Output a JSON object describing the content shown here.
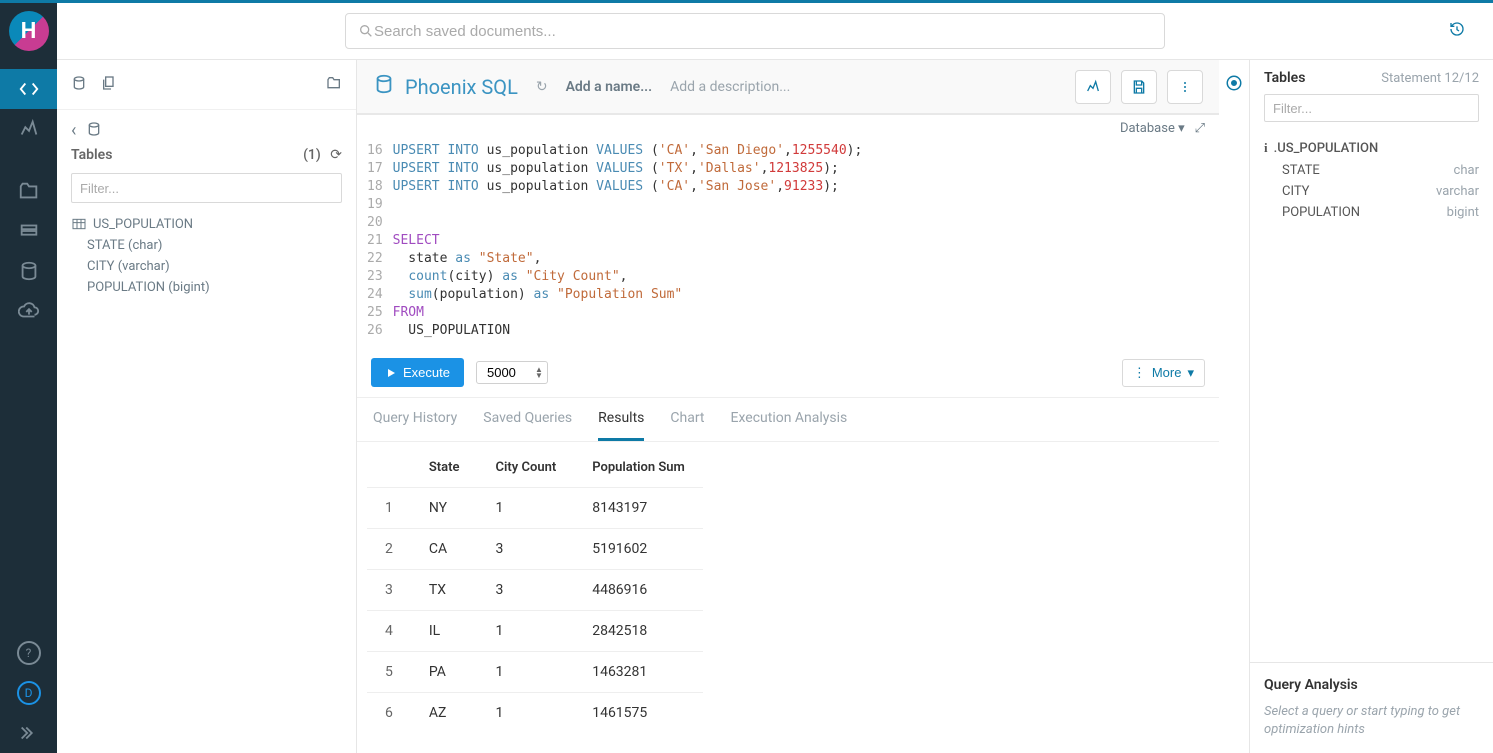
{
  "search": {
    "placeholder": "Search saved documents..."
  },
  "leftRail": {
    "icons": [
      "editor",
      "dashboards",
      "files",
      "tables",
      "database",
      "cloud"
    ],
    "bottom": [
      "help",
      "user",
      "expand"
    ]
  },
  "sidebar": {
    "crumb_back": "‹",
    "heading": "Tables",
    "count": "(1)",
    "filter_placeholder": "Filter...",
    "table": {
      "name": "US_POPULATION",
      "columns": [
        {
          "name": "STATE",
          "type": "char"
        },
        {
          "name": "CITY",
          "type": "varchar"
        },
        {
          "name": "POPULATION",
          "type": "bigint"
        }
      ]
    }
  },
  "query": {
    "engine": "Phoenix SQL",
    "addName": "Add a name...",
    "addDesc": "Add a description...",
    "dbLabel": "Database",
    "execute": "Execute",
    "limit": "5000",
    "more": "More",
    "code": [
      {
        "n": 16,
        "tokens": [
          {
            "t": "UPSERT",
            "c": "kw"
          },
          {
            "t": " "
          },
          {
            "t": "INTO",
            "c": "kw"
          },
          {
            "t": " us_population "
          },
          {
            "t": "VALUES",
            "c": "kw"
          },
          {
            "t": " ("
          },
          {
            "t": "'CA'",
            "c": "str"
          },
          {
            "t": ","
          },
          {
            "t": "'San Diego'",
            "c": "str"
          },
          {
            "t": ","
          },
          {
            "t": "1255540",
            "c": "num"
          },
          {
            "t": ");"
          }
        ]
      },
      {
        "n": 17,
        "tokens": [
          {
            "t": "UPSERT",
            "c": "kw"
          },
          {
            "t": " "
          },
          {
            "t": "INTO",
            "c": "kw"
          },
          {
            "t": " us_population "
          },
          {
            "t": "VALUES",
            "c": "kw"
          },
          {
            "t": " ("
          },
          {
            "t": "'TX'",
            "c": "str"
          },
          {
            "t": ","
          },
          {
            "t": "'Dallas'",
            "c": "str"
          },
          {
            "t": ","
          },
          {
            "t": "1213825",
            "c": "num"
          },
          {
            "t": ");"
          }
        ]
      },
      {
        "n": 18,
        "tokens": [
          {
            "t": "UPSERT",
            "c": "kw"
          },
          {
            "t": " "
          },
          {
            "t": "INTO",
            "c": "kw"
          },
          {
            "t": " us_population "
          },
          {
            "t": "VALUES",
            "c": "kw"
          },
          {
            "t": " ("
          },
          {
            "t": "'CA'",
            "c": "str"
          },
          {
            "t": ","
          },
          {
            "t": "'San Jose'",
            "c": "str"
          },
          {
            "t": ","
          },
          {
            "t": "91233",
            "c": "num"
          },
          {
            "t": ");"
          }
        ]
      },
      {
        "n": 19,
        "tokens": []
      },
      {
        "n": 20,
        "tokens": []
      },
      {
        "n": 21,
        "tokens": [
          {
            "t": "SELECT",
            "c": "kw2"
          }
        ]
      },
      {
        "n": 22,
        "tokens": [
          {
            "t": "  state "
          },
          {
            "t": "as",
            "c": "kw"
          },
          {
            "t": " "
          },
          {
            "t": "\"State\"",
            "c": "str"
          },
          {
            "t": ","
          }
        ]
      },
      {
        "n": 23,
        "tokens": [
          {
            "t": "  "
          },
          {
            "t": "count",
            "c": "kw"
          },
          {
            "t": "(city) "
          },
          {
            "t": "as",
            "c": "kw"
          },
          {
            "t": " "
          },
          {
            "t": "\"City Count\"",
            "c": "str"
          },
          {
            "t": ","
          }
        ]
      },
      {
        "n": 24,
        "tokens": [
          {
            "t": "  "
          },
          {
            "t": "sum",
            "c": "kw"
          },
          {
            "t": "(population) "
          },
          {
            "t": "as",
            "c": "kw"
          },
          {
            "t": " "
          },
          {
            "t": "\"Population Sum\"",
            "c": "str"
          }
        ]
      },
      {
        "n": 25,
        "tokens": [
          {
            "t": "FROM",
            "c": "kw2"
          }
        ]
      },
      {
        "n": 26,
        "tokens": [
          {
            "t": "  US_POPULATION"
          }
        ]
      }
    ]
  },
  "tabs": {
    "items": [
      "Query History",
      "Saved Queries",
      "Results",
      "Chart",
      "Execution Analysis"
    ],
    "active": "Results"
  },
  "results": {
    "columns": [
      "",
      "State",
      "City Count",
      "Population Sum"
    ],
    "rows": [
      [
        "1",
        "NY",
        "1",
        "8143197"
      ],
      [
        "2",
        "CA",
        "3",
        "5191602"
      ],
      [
        "3",
        "TX",
        "3",
        "4486916"
      ],
      [
        "4",
        "IL",
        "1",
        "2842518"
      ],
      [
        "5",
        "PA",
        "1",
        "1463281"
      ],
      [
        "6",
        "AZ",
        "1",
        "1461575"
      ]
    ]
  },
  "rightPanel": {
    "heading": "Tables",
    "statement": "Statement 12/12",
    "filter_placeholder": "Filter...",
    "table": {
      "name": ".US_POPULATION",
      "columns": [
        {
          "name": "STATE",
          "type": "char"
        },
        {
          "name": "CITY",
          "type": "varchar"
        },
        {
          "name": "POPULATION",
          "type": "bigint"
        }
      ]
    },
    "qa_heading": "Query Analysis",
    "qa_hint": "Select a query or start typing to get optimization hints"
  }
}
